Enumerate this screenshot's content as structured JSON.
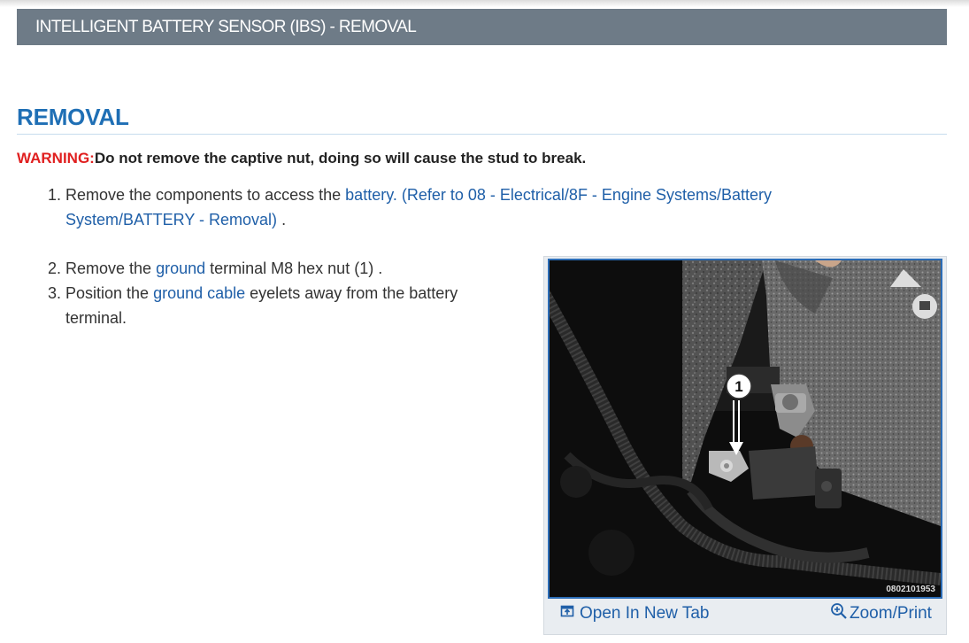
{
  "header": {
    "title": "INTELLIGENT BATTERY SENSOR (IBS) - REMOVAL"
  },
  "section": {
    "title": "REMOVAL"
  },
  "warning": {
    "label": "WARNING:",
    "text": "Do not remove the captive nut, doing so will cause the stud to break."
  },
  "steps": [
    {
      "number": "1.",
      "line1_prefix": "Remove the components to access the ",
      "line1_link": "battery. (Refer to 08 - Electrical/8F - Engine Systems/Battery",
      "line2_link": "System/BATTERY - Removal)",
      "line2_suffix": " ."
    },
    {
      "number": "2.",
      "prefix": "Remove the ",
      "link": "ground",
      "suffix": " terminal M8 hex nut (1) ."
    },
    {
      "number": "3.",
      "prefix": "Position the ",
      "link": "ground cable",
      "suffix": " eyelets away from the battery",
      "line2": "terminal."
    }
  ],
  "figure": {
    "callout": "1",
    "code": "0802101953",
    "open_label": "Open In New Tab",
    "zoom_label": "Zoom/Print",
    "open_icon": "open-new-tab-icon",
    "zoom_icon": "zoom-in-icon"
  }
}
